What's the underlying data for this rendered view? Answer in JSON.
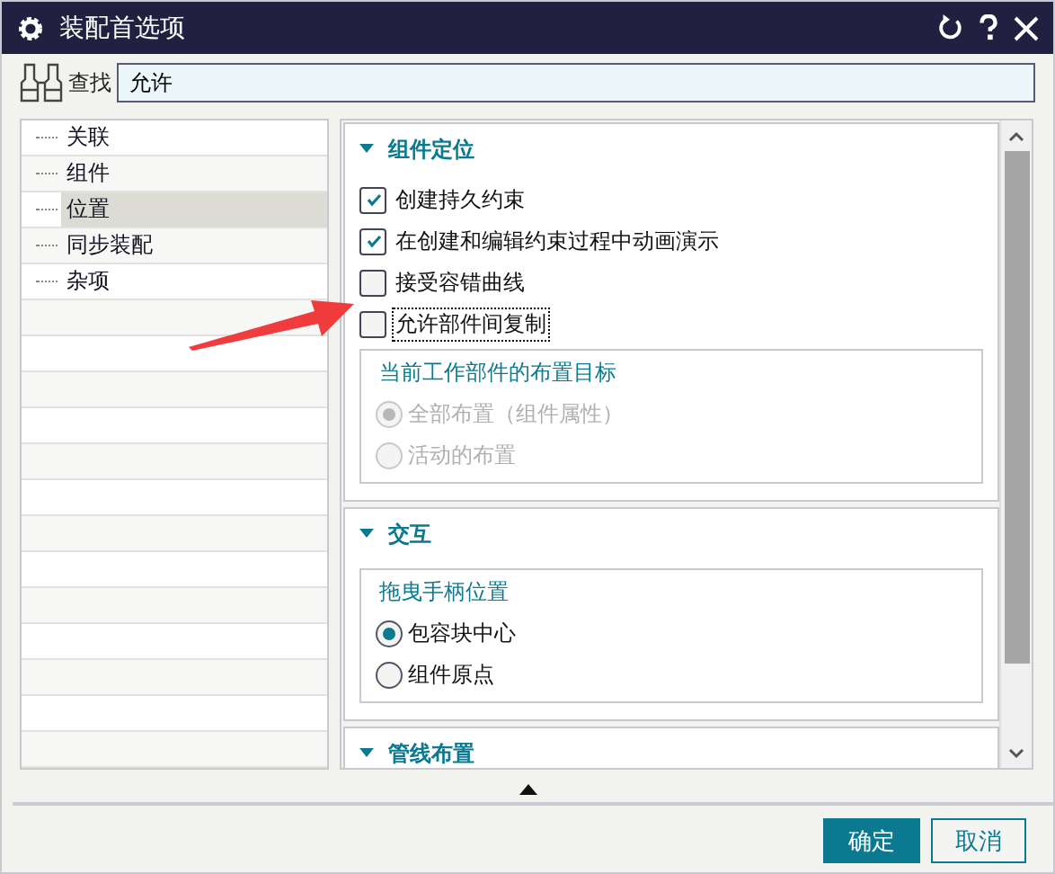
{
  "window": {
    "title": "装配首选项"
  },
  "search": {
    "label": "查找",
    "value": "允许"
  },
  "tree": {
    "items": [
      {
        "label": "关联",
        "selected": false
      },
      {
        "label": "组件",
        "selected": false
      },
      {
        "label": "位置",
        "selected": true
      },
      {
        "label": "同步装配",
        "selected": false
      },
      {
        "label": "杂项",
        "selected": false
      }
    ]
  },
  "sections": [
    {
      "title": "组件定位",
      "expanded": true,
      "items": [
        {
          "kind": "checkbox",
          "label": "创建持久约束",
          "checked": true,
          "focused": false
        },
        {
          "kind": "checkbox",
          "label": "在创建和编辑约束过程中动画演示",
          "checked": true,
          "focused": false
        },
        {
          "kind": "checkbox",
          "label": "接受容错曲线",
          "checked": false,
          "focused": false
        },
        {
          "kind": "checkbox",
          "label": "允许部件间复制",
          "checked": false,
          "focused": true
        },
        {
          "kind": "group",
          "title": "当前工作部件的布置目标",
          "options": [
            {
              "label": "全部布置（组件属性）",
              "selected": true,
              "disabled": true
            },
            {
              "label": "活动的布置",
              "selected": false,
              "disabled": true
            }
          ]
        }
      ]
    },
    {
      "title": "交互",
      "expanded": true,
      "items": [
        {
          "kind": "group",
          "title": "拖曳手柄位置",
          "options": [
            {
              "label": "包容块中心",
              "selected": true,
              "disabled": false
            },
            {
              "label": "组件原点",
              "selected": false,
              "disabled": false
            }
          ]
        }
      ]
    },
    {
      "title": "管线布置",
      "expanded": true
    }
  ],
  "buttons": [
    {
      "label": "确定",
      "primary": true
    },
    {
      "label": "取消",
      "primary": false
    }
  ]
}
